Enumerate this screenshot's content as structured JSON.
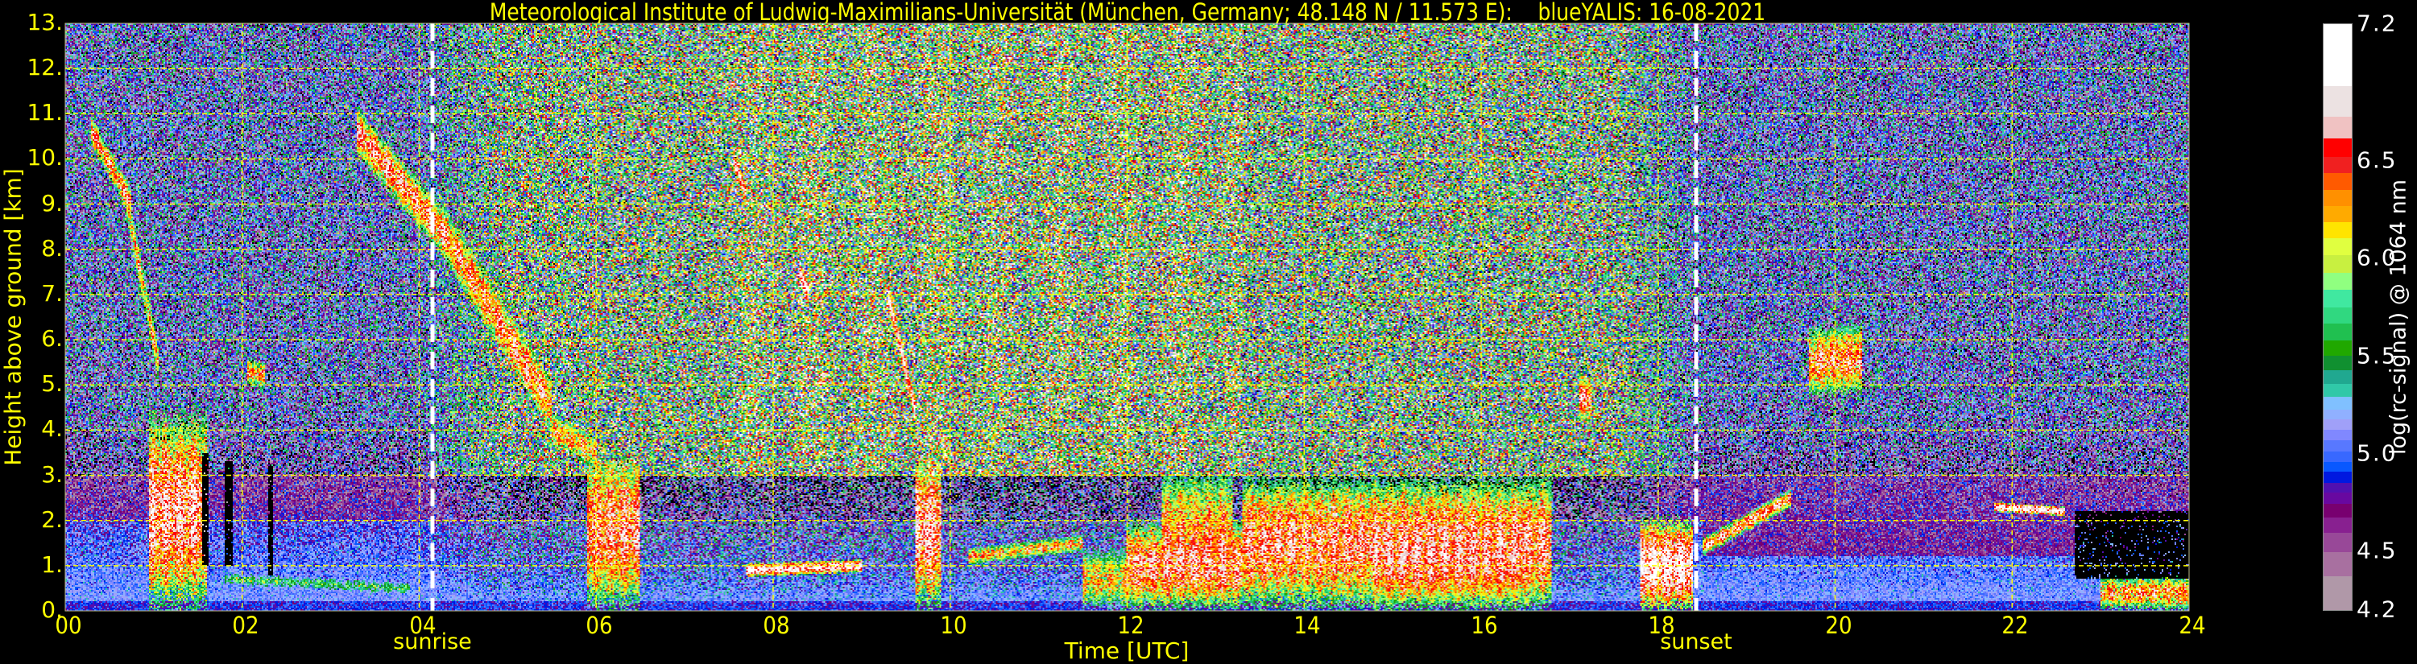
{
  "chart_data": {
    "type": "heatmap",
    "title": "Meteorological Institute of Ludwig-Maximilians-Universität (München, Germany; 48.148 N / 11.573 E):    blueYALIS: 16-08-2021",
    "xlabel": "Time [UTC]",
    "ylabel": "Height above ground [km]",
    "xlim": [
      0,
      24
    ],
    "ylim": [
      0,
      13
    ],
    "x_ticks": [
      0,
      2,
      4,
      6,
      8,
      10,
      12,
      14,
      16,
      18,
      20,
      22,
      24
    ],
    "x_tick_labels": [
      "00",
      "02",
      "04",
      "06",
      "08",
      "10",
      "12",
      "14",
      "16",
      "18",
      "20",
      "22",
      "24"
    ],
    "y_ticks": [
      0,
      1,
      2,
      3,
      4,
      5,
      6,
      7,
      8,
      9,
      10,
      11,
      12,
      13
    ],
    "y_tick_labels": [
      "0.",
      "1.",
      "2.",
      "3.",
      "4.",
      "5.",
      "6.",
      "7.",
      "8.",
      "9.",
      "10.",
      "11.",
      "12.",
      "13."
    ],
    "grid": true,
    "annotations": [
      {
        "label": "sunrise",
        "time": 4.15
      },
      {
        "label": "sunset",
        "time": 18.43
      }
    ],
    "colorbar": {
      "label": "log(rc-signal) @ 1064 nm",
      "range": [
        4.2,
        7.2
      ],
      "ticks": [
        4.2,
        4.5,
        5.0,
        5.5,
        6.0,
        6.5,
        7.2
      ],
      "tick_labels": [
        "4.2",
        "4.5",
        "5.0",
        "5.5",
        "6.0",
        "6.5",
        "7.2"
      ],
      "bounds": [
        7.2,
        6.884,
        6.727,
        6.614,
        6.521,
        6.437,
        6.351,
        6.269,
        6.186,
        6.104,
        6.018,
        5.927,
        5.841,
        5.75,
        5.666,
        5.581,
        5.501,
        5.428,
        5.359,
        5.294,
        5.227,
        5.175,
        5.125,
        5.071,
        5.013,
        4.959,
        4.907,
        4.851,
        4.803,
        4.743,
        4.674,
        4.594,
        4.496,
        4.375,
        4.2
      ],
      "colors": [
        "#ffffff",
        "#ece2e2",
        "#f0c2c2",
        "#ff0000",
        "#f02020",
        "#ff5a00",
        "#ff9000",
        "#ffaa00",
        "#ffe400",
        "#e0ff40",
        "#c8f040",
        "#90ff80",
        "#40e8a0",
        "#30d880",
        "#20c050",
        "#20a800",
        "#109030",
        "#20a890",
        "#30c8a8",
        "#80c0ff",
        "#90b0ff",
        "#a0a0f8",
        "#8088ff",
        "#5878ff",
        "#3868ff",
        "#0858ff",
        "#0018e0",
        "#5010b0",
        "#6808a0",
        "#780070",
        "#882090",
        "#984898",
        "#a870a0",
        "#b098a8"
      ]
    },
    "features_note_units": "time [h UTC], height [km], value log(rc-signal)",
    "features": [
      [
        0.3,
        10.6,
        0.75,
        9.0,
        0.7,
        6.5
      ],
      [
        0.7,
        9.0,
        1.05,
        5.5,
        0.9,
        6.3
      ],
      [
        0.95,
        2.2,
        1.6,
        2.2,
        4.4,
        6.7
      ],
      [
        1.8,
        0.7,
        3.9,
        0.5,
        0.35,
        5.6
      ],
      [
        2.05,
        5.3,
        2.25,
        5.2,
        0.6,
        6.4
      ],
      [
        3.3,
        10.6,
        4.3,
        8.3,
        1.1,
        6.6
      ],
      [
        4.3,
        8.3,
        5.5,
        4.5,
        1.3,
        6.5
      ],
      [
        5.5,
        4.0,
        6.0,
        3.5,
        0.8,
        6.3
      ],
      [
        5.9,
        1.8,
        6.5,
        1.8,
        3.6,
        6.6
      ],
      [
        7.55,
        10.0,
        7.7,
        9.2,
        0.5,
        6.8
      ],
      [
        8.3,
        7.5,
        8.4,
        7.0,
        0.6,
        6.8
      ],
      [
        9.3,
        7.0,
        9.6,
        4.5,
        0.6,
        6.8
      ],
      [
        9.6,
        1.8,
        9.9,
        1.8,
        3.6,
        6.7
      ],
      [
        7.7,
        0.9,
        9.0,
        1.0,
        0.3,
        6.9
      ],
      [
        10.2,
        1.2,
        11.5,
        1.5,
        0.4,
        6.3
      ],
      [
        11.5,
        0.7,
        12.0,
        0.7,
        1.4,
        6.2
      ],
      [
        12.0,
        1.0,
        13.3,
        1.0,
        2.0,
        6.6
      ],
      [
        12.4,
        1.6,
        13.2,
        1.6,
        3.2,
        6.4
      ],
      [
        13.3,
        1.5,
        16.8,
        1.5,
        3.0,
        6.6
      ],
      [
        14.8,
        1.0,
        16.5,
        1.0,
        2.0,
        6.5
      ],
      [
        17.1,
        4.8,
        17.25,
        4.6,
        1.2,
        6.5
      ],
      [
        17.8,
        1.0,
        18.4,
        1.0,
        2.0,
        6.9
      ],
      [
        18.5,
        1.4,
        19.5,
        2.5,
        0.4,
        6.6
      ],
      [
        19.7,
        5.5,
        20.3,
        5.6,
        1.6,
        6.5
      ],
      [
        21.8,
        2.3,
        22.6,
        2.2,
        0.2,
        7.0
      ],
      [
        23.0,
        0.4,
        24.0,
        0.4,
        0.8,
        6.4
      ]
    ],
    "no_signal_regions": [
      [
        22.7,
        24.0,
        0.7,
        2.2
      ],
      [
        1.55,
        1.62,
        1.0,
        3.5
      ],
      [
        1.8,
        1.9,
        1.0,
        3.3
      ],
      [
        2.3,
        2.35,
        0.8,
        3.2
      ]
    ]
  },
  "colors": {
    "axis_text": "#ffff00",
    "grid": "#ffff00",
    "daylight_marker": "#ffffff",
    "colorbar_text": "#ffffff"
  }
}
